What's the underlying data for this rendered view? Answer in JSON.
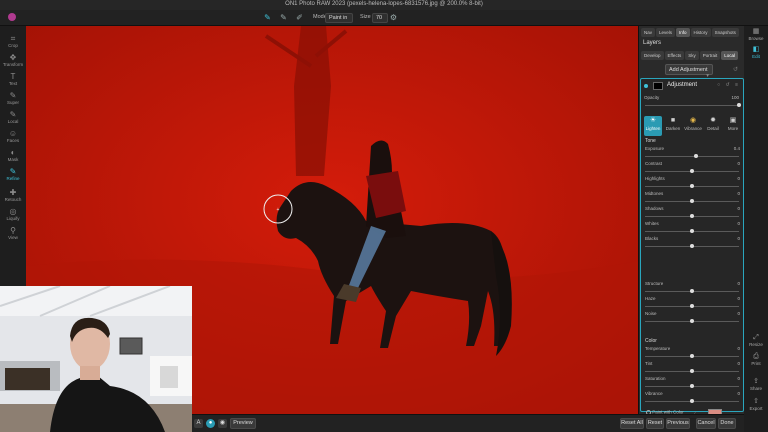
{
  "title": "ON1 Photo RAW 2023 (pexels-helena-lopes-6831576.jpg @ 200.0% 8-bit)",
  "options_bar": {
    "mode_label": "Mode",
    "mode_value": "Paint in",
    "size_label": "Size",
    "size_value": "70"
  },
  "left_tools": [
    {
      "label": "Crop",
      "icon": "crop-icon"
    },
    {
      "label": "Transform",
      "icon": "move-icon"
    },
    {
      "label": "Text",
      "icon": "text-icon"
    },
    {
      "label": "Super",
      "icon": "brush-icon"
    },
    {
      "label": "Local",
      "icon": "brush-icon"
    },
    {
      "label": "Faces",
      "icon": "face-icon"
    },
    {
      "label": "Mask",
      "icon": "mask-icon"
    },
    {
      "label": "Refine",
      "icon": "refine-brush-icon",
      "active": true
    },
    {
      "label": "Retouch",
      "icon": "retouch-icon"
    },
    {
      "label": "Liquify",
      "icon": "liquify-icon"
    },
    {
      "label": "View",
      "icon": "zoom-icon"
    }
  ],
  "right_panel": {
    "tabs_top": [
      "Nav",
      "Levels",
      "Info",
      "History",
      "Snapshots"
    ],
    "tabs_top_active": "Info",
    "layers_title": "Layers",
    "tabs_sub": [
      "Develop",
      "Effects",
      "Sky",
      "Portrait",
      "Local"
    ],
    "tabs_sub_active": "Local",
    "add_adjustment": "Add Adjustment",
    "adjustment_title": "Adjustment",
    "opacity_label": "Opacity",
    "opacity_value": "100",
    "presets": [
      {
        "label": "Lighten",
        "icon": "sun-icon",
        "active": true
      },
      {
        "label": "Darken",
        "icon": "moon-icon"
      },
      {
        "label": "Vibrance",
        "icon": "color-wheel-icon"
      },
      {
        "label": "Detail",
        "icon": "sparkle-icon"
      },
      {
        "label": "More",
        "icon": "chevron-down-icon"
      }
    ],
    "tone_label": "Tone",
    "tone_sliders": [
      {
        "label": "Exposure",
        "value": "0.4",
        "level": 0.54
      },
      {
        "label": "Contrast",
        "value": "0",
        "level": 0.5
      },
      {
        "label": "Highlights",
        "value": "0",
        "level": 0.5
      },
      {
        "label": "Midtones",
        "value": "0",
        "level": 0.5
      },
      {
        "label": "Shadows",
        "value": "0",
        "level": 0.5
      },
      {
        "label": "Whites",
        "value": "0",
        "level": 0.5
      },
      {
        "label": "Blacks",
        "value": "0",
        "level": 0.5
      }
    ],
    "detail_sliders": [
      {
        "label": "Structure",
        "value": "0",
        "level": 0.5
      },
      {
        "label": "Haze",
        "value": "0",
        "level": 0.5
      },
      {
        "label": "Noise",
        "value": "0",
        "level": 0.5
      }
    ],
    "color_label": "Color",
    "color_sliders": [
      {
        "label": "Temperature",
        "value": "0",
        "level": 0.5
      },
      {
        "label": "Tint",
        "value": "0",
        "level": 0.5
      },
      {
        "label": "Saturation",
        "value": "0",
        "level": 0.5
      },
      {
        "label": "Vibrance",
        "value": "0",
        "level": 0.5
      }
    ],
    "paint_with_color": "Paint with Color"
  },
  "far_right": [
    {
      "label": "Browse",
      "icon": "grid-icon"
    },
    {
      "label": "Edit",
      "icon": "edit-icon",
      "active": true
    },
    {
      "label": "Resize",
      "icon": "resize-icon"
    },
    {
      "label": "Print",
      "icon": "print-icon"
    },
    {
      "label": "Share",
      "icon": "share-icon"
    },
    {
      "label": "Export",
      "icon": "export-icon"
    }
  ],
  "bottom_bar": {
    "preview": "Preview",
    "reset_all": "Reset All",
    "reset": "Reset",
    "previous": "Previous",
    "cancel": "Cancel",
    "done": "Done"
  },
  "colors": {
    "accent": "#3fc1d8",
    "mask_overlay": "#c21708",
    "paint_swatch": "#d98c82"
  }
}
